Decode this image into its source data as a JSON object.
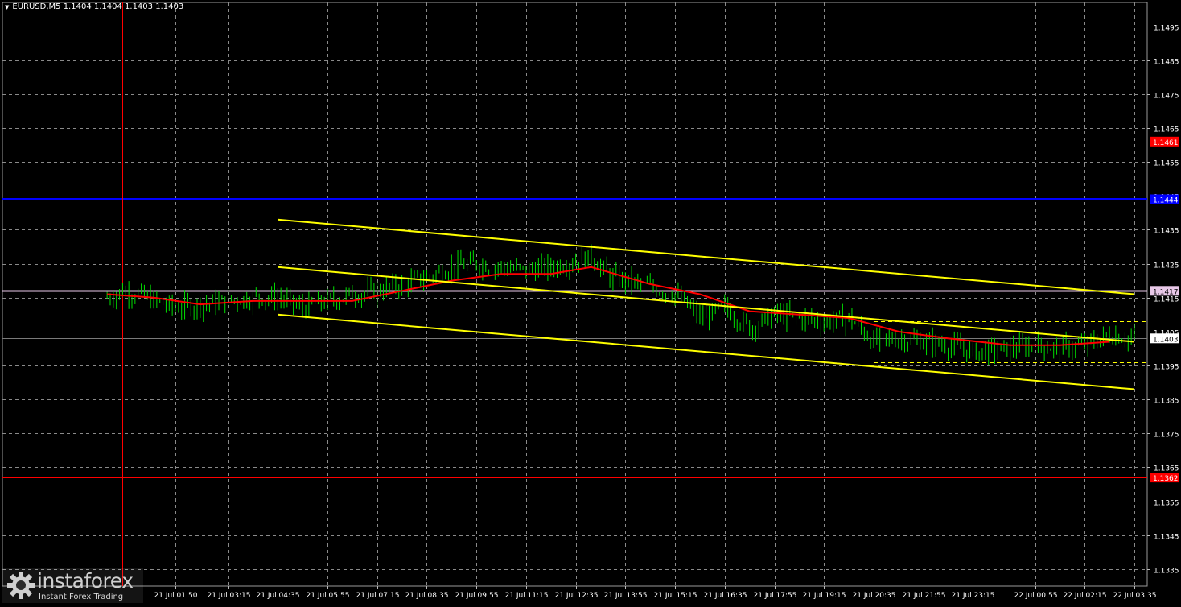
{
  "header": {
    "title": "EURUSD,M5  1.1404 1.1404 1.1403 1.1403"
  },
  "watermark": {
    "brand": "instaforex",
    "tagline": "Instant Forex Trading"
  },
  "chart_data": {
    "type": "candlestick",
    "symbol": "EURUSD",
    "timeframe": "M5",
    "ylim": [
      1.133,
      1.1502
    ],
    "y_ticks": [
      "1.1495",
      "1.1485",
      "1.1475",
      "1.1465",
      "1.1455",
      "1.1445",
      "1.1435",
      "1.1425",
      "1.1415",
      "1.1405",
      "1.1395",
      "1.1385",
      "1.1375",
      "1.1365",
      "1.1355",
      "1.1345",
      "1.1335"
    ],
    "x_ticks": [
      "21 Jul 01:50",
      "21 Jul 03:15",
      "21 Jul 04:35",
      "21 Jul 05:55",
      "21 Jul 07:15",
      "21 Jul 08:35",
      "21 Jul 09:55",
      "21 Jul 11:15",
      "21 Jul 12:35",
      "21 Jul 13:55",
      "21 Jul 15:15",
      "21 Jul 16:35",
      "21 Jul 17:55",
      "21 Jul 19:15",
      "21 Jul 20:35",
      "21 Jul 21:55",
      "21 Jul 23:15",
      "22 Jul 00:55",
      "22 Jul 02:15",
      "22 Jul 03:35"
    ],
    "price_path": [
      [
        "21 Jul 00:00",
        1.1415
      ],
      [
        "21 Jul 00:25",
        1.1417
      ],
      [
        "21 Jul 00:50",
        1.1416
      ],
      [
        "21 Jul 01:15",
        1.1414
      ],
      [
        "21 Jul 01:50",
        1.1412
      ],
      [
        "21 Jul 02:30",
        1.1413
      ],
      [
        "21 Jul 03:15",
        1.1414
      ],
      [
        "21 Jul 03:55",
        1.1415
      ],
      [
        "21 Jul 04:35",
        1.1415
      ],
      [
        "21 Jul 05:15",
        1.1412
      ],
      [
        "21 Jul 05:55",
        1.1414
      ],
      [
        "21 Jul 06:35",
        1.1416
      ],
      [
        "21 Jul 07:15",
        1.1417
      ],
      [
        "21 Jul 07:55",
        1.1419
      ],
      [
        "21 Jul 08:35",
        1.1421
      ],
      [
        "21 Jul 09:15",
        1.1424
      ],
      [
        "21 Jul 09:55",
        1.1425
      ],
      [
        "21 Jul 10:35",
        1.1424
      ],
      [
        "21 Jul 11:15",
        1.1423
      ],
      [
        "21 Jul 11:55",
        1.1424
      ],
      [
        "21 Jul 12:35",
        1.1426
      ],
      [
        "21 Jul 13:00",
        1.1427
      ],
      [
        "21 Jul 13:30",
        1.1421
      ],
      [
        "21 Jul 13:55",
        1.142
      ],
      [
        "21 Jul 14:35",
        1.1418
      ],
      [
        "21 Jul 15:15",
        1.1416
      ],
      [
        "21 Jul 15:55",
        1.1409
      ],
      [
        "21 Jul 16:35",
        1.1412
      ],
      [
        "21 Jul 17:15",
        1.1406
      ],
      [
        "21 Jul 17:55",
        1.141
      ],
      [
        "21 Jul 18:35",
        1.1409
      ],
      [
        "21 Jul 19:15",
        1.1408
      ],
      [
        "21 Jul 19:55",
        1.1409
      ],
      [
        "21 Jul 20:35",
        1.1402
      ],
      [
        "21 Jul 21:15",
        1.1403
      ],
      [
        "21 Jul 21:55",
        1.1402
      ],
      [
        "21 Jul 22:35",
        1.1401
      ],
      [
        "21 Jul 23:15",
        1.1399
      ],
      [
        "22 Jul 00:15",
        1.14
      ],
      [
        "22 Jul 00:55",
        1.1401
      ],
      [
        "22 Jul 01:35",
        1.14
      ],
      [
        "22 Jul 02:15",
        1.1401
      ],
      [
        "22 Jul 02:55",
        1.1404
      ],
      [
        "22 Jul 03:35",
        1.1403
      ]
    ],
    "moving_average": [
      [
        "21 Jul 00:00",
        1.1416
      ],
      [
        "21 Jul 01:15",
        1.1415
      ],
      [
        "21 Jul 02:30",
        1.1413
      ],
      [
        "21 Jul 03:55",
        1.1414
      ],
      [
        "21 Jul 05:15",
        1.1414
      ],
      [
        "21 Jul 06:35",
        1.1414
      ],
      [
        "21 Jul 07:55",
        1.1417
      ],
      [
        "21 Jul 09:15",
        1.142
      ],
      [
        "21 Jul 10:35",
        1.1422
      ],
      [
        "21 Jul 11:55",
        1.1422
      ],
      [
        "21 Jul 13:00",
        1.1424
      ],
      [
        "21 Jul 14:35",
        1.1419
      ],
      [
        "21 Jul 15:55",
        1.1416
      ],
      [
        "21 Jul 17:15",
        1.1411
      ],
      [
        "21 Jul 18:35",
        1.141
      ],
      [
        "21 Jul 19:55",
        1.1409
      ],
      [
        "21 Jul 21:15",
        1.1405
      ],
      [
        "21 Jul 22:35",
        1.1403
      ],
      [
        "22 Jul 00:15",
        1.1401
      ],
      [
        "22 Jul 01:35",
        1.1401
      ],
      [
        "22 Jul 02:55",
        1.1402
      ]
    ],
    "trend_channel": [
      {
        "from": [
          "21 Jul 04:35",
          1.1438
        ],
        "to": [
          "22 Jul 03:35",
          1.1416
        ]
      },
      {
        "from": [
          "21 Jul 04:35",
          1.1424
        ],
        "to": [
          "22 Jul 03:35",
          1.1402
        ]
      },
      {
        "from": [
          "21 Jul 04:35",
          1.141
        ],
        "to": [
          "22 Jul 03:35",
          1.1388
        ]
      }
    ],
    "horizontal_levels": [
      {
        "price": 1.1461,
        "label": "1.1461",
        "color": "#ff0000"
      },
      {
        "price": 1.1444,
        "label": "1.1444",
        "color": "#0000ff"
      },
      {
        "price": 1.1417,
        "label": "1.1417",
        "color": "#e8c8e8"
      },
      {
        "price": 1.1362,
        "label": "1.1362",
        "color": "#ff0000"
      }
    ],
    "dashed_levels": [
      {
        "price": 1.1408,
        "color": "#ffff00"
      },
      {
        "price": 1.1396,
        "color": "#ffff00"
      }
    ],
    "current_price": {
      "price": 1.1403,
      "label": "1.1403"
    },
    "day_separators": [
      "21 Jul 00:25",
      "21 Jul 23:15"
    ],
    "colors": {
      "background": "#000000",
      "candles": "#00e000",
      "ma": "#ff0000",
      "channel": "#ffff00",
      "grid": "#8a8a8a",
      "axis_text": "#ffffff"
    },
    "grid": true
  }
}
